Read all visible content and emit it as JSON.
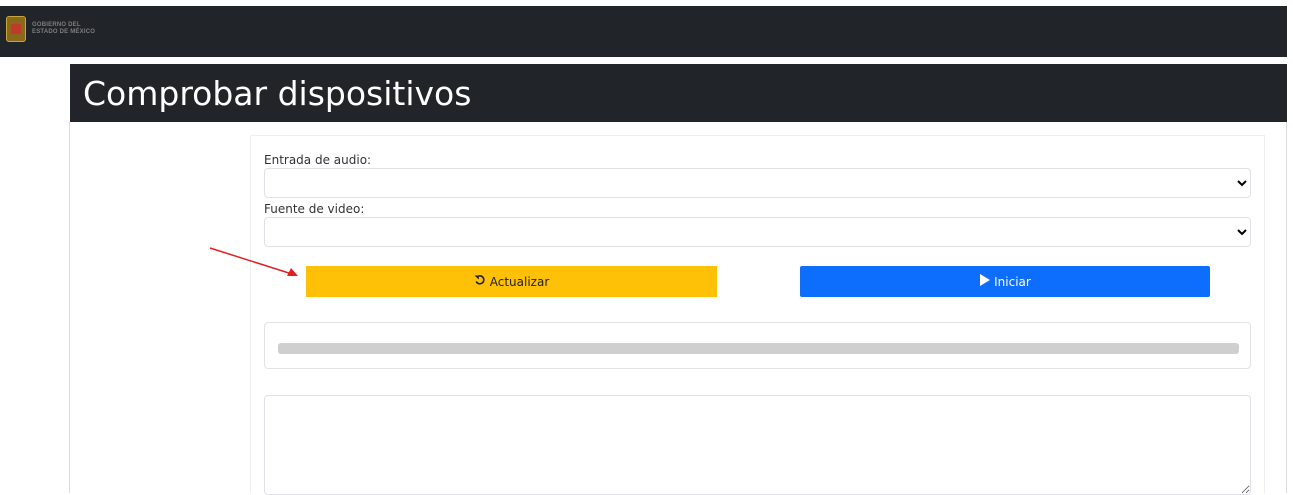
{
  "header": {
    "logo_line1": "GOBIERNO DEL",
    "logo_line2": "ESTADO DE MÉXICO"
  },
  "page": {
    "title": "Comprobar dispositivos"
  },
  "form": {
    "audio_label": "Entrada de audio:",
    "audio_value": "",
    "video_label": "Fuente de video:",
    "video_value": ""
  },
  "buttons": {
    "refresh_label": "Actualizar",
    "refresh_icon": "rotate-left-icon",
    "start_label": "Iniciar",
    "start_icon": "play-icon"
  },
  "progress": {
    "fraction": 1.0
  },
  "colors": {
    "topbar": "#212529",
    "warning": "#ffc107",
    "primary": "#0d6efd",
    "annotation_arrow": "#e02020"
  }
}
